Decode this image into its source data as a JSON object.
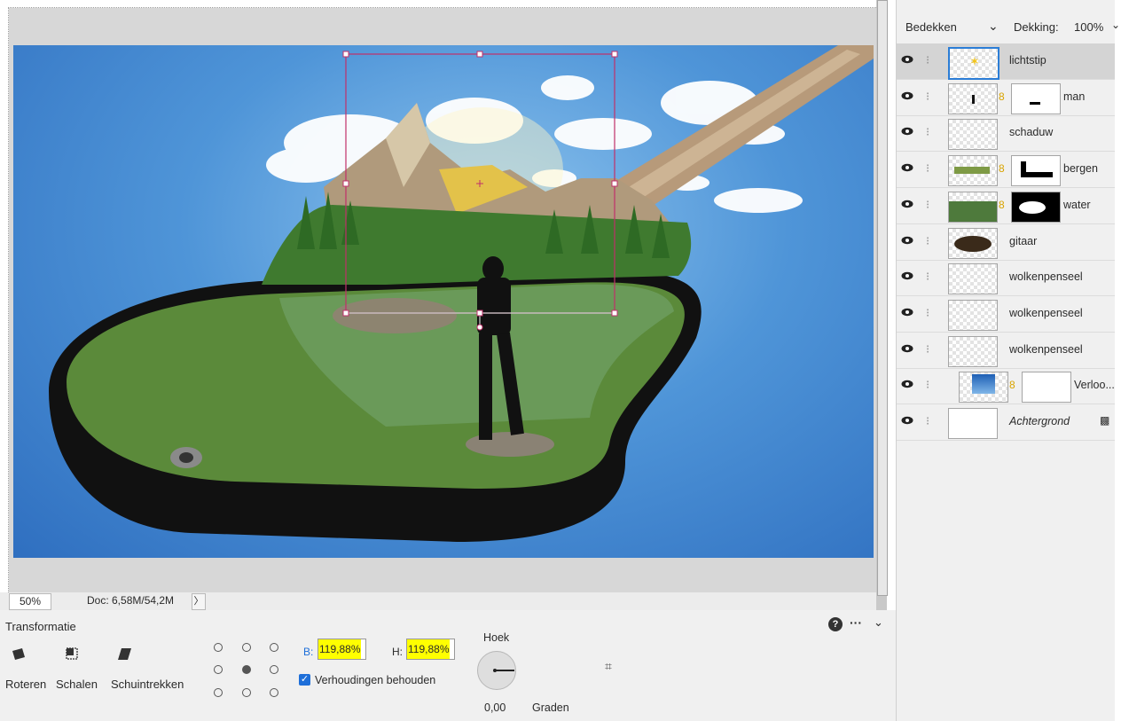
{
  "canvas": {
    "zoom": "50%",
    "doc_info": "Doc: 6,58M/54,2M",
    "status_menu_arrow": "〉"
  },
  "layers_panel": {
    "blend_mode": "Bedekken",
    "opacity_label": "Dekking:",
    "opacity_value": "100%",
    "layers": [
      {
        "name": "lichtstip",
        "selected": true,
        "has_mask": false
      },
      {
        "name": "man",
        "selected": false,
        "has_mask": true
      },
      {
        "name": "schaduw",
        "selected": false,
        "has_mask": false
      },
      {
        "name": "bergen",
        "selected": false,
        "has_mask": true
      },
      {
        "name": "water",
        "selected": false,
        "has_mask": true
      },
      {
        "name": "gitaar",
        "selected": false,
        "has_mask": false
      },
      {
        "name": "wolkenpenseel",
        "selected": false,
        "has_mask": false
      },
      {
        "name": "wolkenpenseel",
        "selected": false,
        "has_mask": false
      },
      {
        "name": "wolkenpenseel",
        "selected": false,
        "has_mask": false
      },
      {
        "name": "Verloo...",
        "selected": false,
        "has_mask": true
      },
      {
        "name": "Achtergrond",
        "selected": false,
        "has_mask": false,
        "locked": true
      }
    ]
  },
  "properties": {
    "title": "Transformatie",
    "tools": [
      {
        "icon": "rotate-icon",
        "label": "Roteren"
      },
      {
        "icon": "scale-icon",
        "label": "Schalen"
      },
      {
        "icon": "skew-icon",
        "label": "Schuintrekken"
      }
    ],
    "width_label": "B:",
    "width_value": "119,88%",
    "height_label": "H:",
    "height_value": "119,88%",
    "keep_ratio_label": "Verhoudingen behouden",
    "keep_ratio_checked": true,
    "angle_title": "Hoek",
    "angle_value": "0,00",
    "angle_unit": "Graden",
    "help_glyph": "?",
    "more_glyph": "···",
    "collapse_glyph": "⌄"
  },
  "colors": {
    "highlight": "#ffff00",
    "selection_frame": "#c0306a",
    "checkbox": "#1e6fd9",
    "mask_link": "#d9a400"
  }
}
